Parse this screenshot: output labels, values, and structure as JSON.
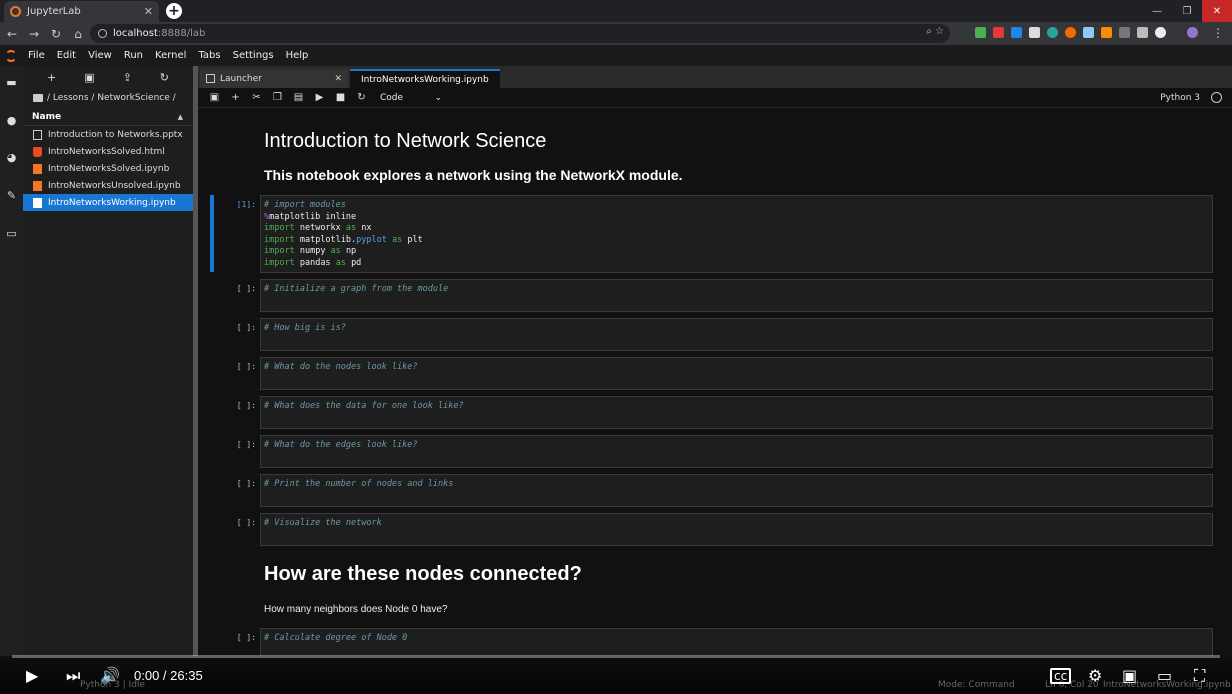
{
  "browser": {
    "tab_title": "JupyterLab",
    "tab_close": "✕",
    "new_tab": "+",
    "url_host": "localhost",
    "url_path": ":8888/lab",
    "window_buttons": [
      "—",
      "❐",
      "✕"
    ]
  },
  "menu": [
    "File",
    "Edit",
    "View",
    "Run",
    "Kernel",
    "Tabs",
    "Settings",
    "Help"
  ],
  "filebrowser": {
    "breadcrumb": "/ Lessons / NetworkScience /",
    "column_name": "Name",
    "files": [
      {
        "name": "Introduction to Networks.pptx",
        "type": "doc"
      },
      {
        "name": "IntroNetworksSolved.html",
        "type": "html"
      },
      {
        "name": "IntroNetworksSolved.ipynb",
        "type": "nb"
      },
      {
        "name": "IntroNetworksUnsolved.ipynb",
        "type": "nb"
      },
      {
        "name": "IntroNetworksWorking.ipynb",
        "type": "nb",
        "selected": true
      }
    ]
  },
  "tabs": {
    "launcher": "Launcher",
    "notebook": "IntroNetworksWorking.ipynb"
  },
  "toolbar": {
    "cell_type": "Code",
    "kernel": "Python 3"
  },
  "notebook": {
    "title": "Introduction to Network Science",
    "subtitle": "This notebook explores a network using the NetworkX module.",
    "cell1_prompt": "[1]:",
    "cell1": {
      "comment": "# import modules",
      "magic_pct": "%",
      "magic_rest": "matplotlib inline",
      "imp": "import",
      "as": "as",
      "m1": "networkx",
      "a1": "nx",
      "m2a": "matplotlib.",
      "m2b": "pyplot",
      "a2": "plt",
      "m3": "numpy",
      "a3": "np",
      "m4": "pandas",
      "a4": "pd"
    },
    "empty_prompt": "[ ]:",
    "comments": [
      "# Initialize a graph from the module",
      "# How big is is?",
      "# What do the nodes look like?",
      "# What does the data for one look like?",
      "# What do the edges look like?",
      "# Print the number of nodes and links",
      "# Visualize the network"
    ],
    "section_title": "How are these nodes connected?",
    "question": "How many neighbors does Node 0 have?",
    "last_comment": "# Calculate degree of Node 0"
  },
  "player": {
    "time": "0:00 / 26:35"
  },
  "statusbar": {
    "left": "Python 3 | Idle",
    "mode": "Mode: Command",
    "pos": "Ln 6, Col 20",
    "file": "IntroNetworksWorking.ipynb"
  }
}
